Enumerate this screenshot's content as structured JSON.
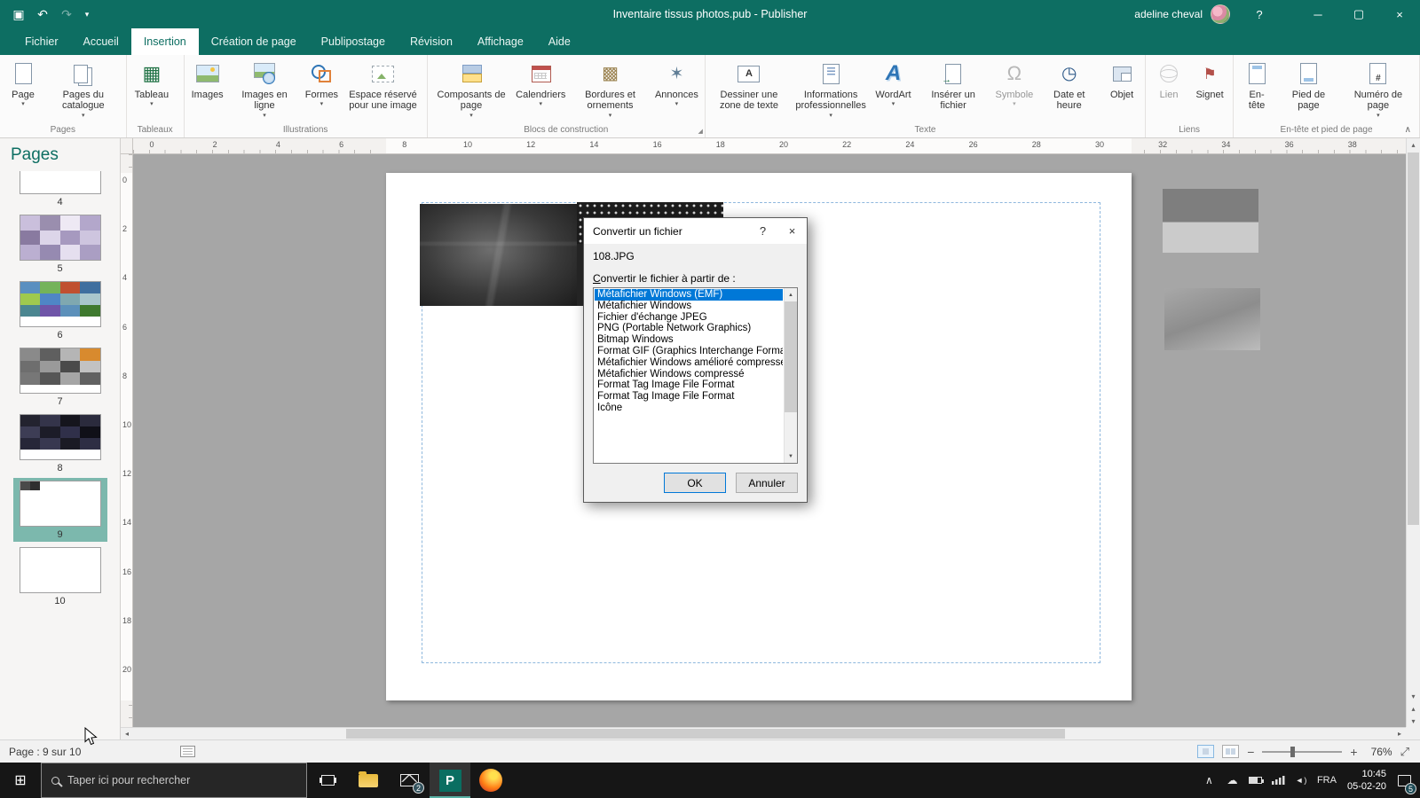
{
  "app": {
    "title": "Inventaire tissus photos.pub  -  Publisher",
    "user": "adeline cheval",
    "help_label": "?"
  },
  "ribbon": {
    "tabs": [
      {
        "label": "Fichier",
        "active": false
      },
      {
        "label": "Accueil",
        "active": false
      },
      {
        "label": "Insertion",
        "active": true
      },
      {
        "label": "Création de page",
        "active": false
      },
      {
        "label": "Publipostage",
        "active": false
      },
      {
        "label": "Révision",
        "active": false
      },
      {
        "label": "Affichage",
        "active": false
      },
      {
        "label": "Aide",
        "active": false
      }
    ],
    "groups": [
      {
        "label": "Pages",
        "buttons": [
          {
            "label": "Page",
            "icon": "page-icon",
            "glyph": "",
            "color": "",
            "dropdown": true
          },
          {
            "label": "Pages du catalogue",
            "icon": "catalog-pages-icon",
            "glyph": "",
            "color": "",
            "dropdown": true
          }
        ]
      },
      {
        "label": "Tableaux",
        "buttons": [
          {
            "label": "Tableau",
            "icon": "table-icon",
            "glyph": "▦",
            "color": "#217346",
            "dropdown": true
          }
        ]
      },
      {
        "label": "Illustrations",
        "buttons": [
          {
            "label": "Images",
            "icon": "images-icon",
            "glyph": "",
            "color": ""
          },
          {
            "label": "Images en ligne",
            "icon": "online-images-icon",
            "glyph": "",
            "color": "",
            "dropdown": true
          },
          {
            "label": "Formes",
            "icon": "shapes-icon",
            "glyph": "",
            "color": "",
            "dropdown": true
          },
          {
            "label": "Espace réservé pour une image",
            "icon": "picture-placeholder-icon",
            "glyph": "",
            "color": ""
          }
        ]
      },
      {
        "label": "Blocs de construction",
        "dialog_launcher": true,
        "buttons": [
          {
            "label": "Composants de page",
            "icon": "page-parts-icon",
            "glyph": "",
            "color": "",
            "dropdown": true
          },
          {
            "label": "Calendriers",
            "icon": "calendars-icon",
            "glyph": "",
            "color": "",
            "dropdown": true
          },
          {
            "label": "Bordures et ornements",
            "icon": "borders-accents-icon",
            "glyph": "▩",
            "color": "#9c8452",
            "dropdown": true
          },
          {
            "label": "Annonces",
            "icon": "advertisements-icon",
            "glyph": "✶",
            "color": "#5f7d95",
            "dropdown": true
          }
        ]
      },
      {
        "label": "Texte",
        "buttons": [
          {
            "label": "Dessiner une zone de texte",
            "icon": "textbox-icon",
            "glyph": "",
            "color": ""
          },
          {
            "label": "Informations professionnelles",
            "icon": "business-info-icon",
            "glyph": "",
            "color": "",
            "dropdown": true
          },
          {
            "label": "WordArt",
            "icon": "wordart-icon",
            "glyph": "A",
            "color": "#2e75b6",
            "dropdown": true
          },
          {
            "label": "Insérer un fichier",
            "icon": "insert-file-icon",
            "glyph": "",
            "color": ""
          },
          {
            "label": "Symbole",
            "icon": "symbol-icon",
            "gly": "",
            "glyph": "Ω",
            "color": "#757575",
            "dropdown": true,
            "disabled": true
          },
          {
            "label": "Date et heure",
            "icon": "datetime-icon",
            "glyph": "◷",
            "color": "#335e8c"
          },
          {
            "label": "Objet",
            "icon": "object-icon",
            "glyph": "",
            "color": ""
          }
        ]
      },
      {
        "label": "Liens",
        "buttons": [
          {
            "label": "Lien",
            "icon": "link-icon",
            "glyph": "",
            "color": "",
            "disabled": true
          },
          {
            "label": "Signet",
            "icon": "bookmark-icon",
            "glyph": "⚑",
            "color": "#b3504a"
          }
        ]
      },
      {
        "label": "En-tête et pied de page",
        "buttons": [
          {
            "label": "En-tête",
            "icon": "header-icon",
            "glyph": "",
            "color": ""
          },
          {
            "label": "Pied de page",
            "icon": "footer-icon",
            "glyph": "",
            "color": ""
          },
          {
            "label": "Numéro de page",
            "icon": "page-number-icon",
            "glyph": "",
            "color": "",
            "dropdown": true
          }
        ]
      }
    ]
  },
  "pages_panel": {
    "title": "Pages",
    "pages": [
      {
        "num": "4",
        "cols": 4,
        "coverage": 0.5,
        "selected": false,
        "colors": [
          "#a79a8b",
          "#8f96a1",
          "#b9ac9e",
          "#7b7166",
          "#9aa2ad",
          "#c7bcae",
          "#6f6a76",
          "#b1a595"
        ]
      },
      {
        "num": "5",
        "cols": 4,
        "coverage": 1,
        "selected": false,
        "colors": [
          "#cabfdc",
          "#9a8eae",
          "#eee9f4",
          "#b3a7cb",
          "#897aa0",
          "#dcd5e9",
          "#a699bf",
          "#cec5df",
          "#bbafd1",
          "#968ab1",
          "#e5dfef",
          "#aa9ec3"
        ]
      },
      {
        "num": "6",
        "cols": 4,
        "coverage": 0.78,
        "selected": false,
        "colors": [
          "#5a8fc0",
          "#74b35a",
          "#c05030",
          "#3f6f9f",
          "#9fc94e",
          "#4f86c6",
          "#7fa8b0",
          "#a8c6cc",
          "#4b8690",
          "#6f55a8",
          "#5c90ba",
          "#3f7a2f"
        ]
      },
      {
        "num": "7",
        "cols": 4,
        "coverage": 0.82,
        "selected": false,
        "colors": [
          "#8a8a8a",
          "#5f5f5f",
          "#b5b5b5",
          "#d88a2e",
          "#6e6e6e",
          "#9a9a9a",
          "#4a4a4a",
          "#c2c2c2",
          "#777777",
          "#565656",
          "#a5a5a5",
          "#616161"
        ]
      },
      {
        "num": "8",
        "cols": 4,
        "coverage": 0.78,
        "selected": false,
        "colors": [
          "#23232f",
          "#34344a",
          "#15151d",
          "#2b2b3d",
          "#3d3d55",
          "#1c1c28",
          "#30304a",
          "#101018",
          "#262638",
          "#383850",
          "#1a1a24",
          "#2e2e44"
        ]
      },
      {
        "num": "9",
        "cols": 8,
        "coverage": 0.2,
        "selected": true,
        "colors": [
          "#4a4a4a",
          "#2f2f2f"
        ]
      },
      {
        "num": "10",
        "cols": 4,
        "coverage": 0,
        "selected": false,
        "colors": []
      }
    ]
  },
  "rulers": {
    "horizontal": [
      "0",
      "2",
      "4",
      "6",
      "8",
      "10",
      "12",
      "14",
      "16",
      "18",
      "20",
      "22",
      "24",
      "26",
      "28",
      "30",
      "32",
      "34",
      "36",
      "38"
    ],
    "vertical": [
      "0",
      "2",
      "4",
      "6",
      "8",
      "10",
      "12",
      "14",
      "16",
      "18",
      "20"
    ]
  },
  "dialog": {
    "title": "Convertir un fichier",
    "help_label": "?",
    "filename": "108.JPG",
    "prompt": "Convertir le fichier à partir de :",
    "options": [
      "Métafichier Windows (EMF)",
      "Métafichier Windows",
      "Fichier d'échange JPEG",
      "PNG (Portable Network Graphics)",
      "Bitmap Windows",
      "Format GIF (Graphics Interchange Format)",
      "Métafichier Windows amélioré compressé",
      "Métafichier Windows compressé",
      "Format Tag Image File Format",
      "Format Tag Image File Format",
      "Icône"
    ],
    "selected_index": 0,
    "ok_label": "OK",
    "cancel_label": "Annuler"
  },
  "status_bar": {
    "page_indicator": "Page : 9 sur 10",
    "zoom": "76%"
  },
  "taskbar": {
    "search_placeholder": "Taper ici pour rechercher",
    "language": "FRA",
    "time": "10:45",
    "date": "05-02-20",
    "mail_badge": "2",
    "notification_badge": "5"
  }
}
